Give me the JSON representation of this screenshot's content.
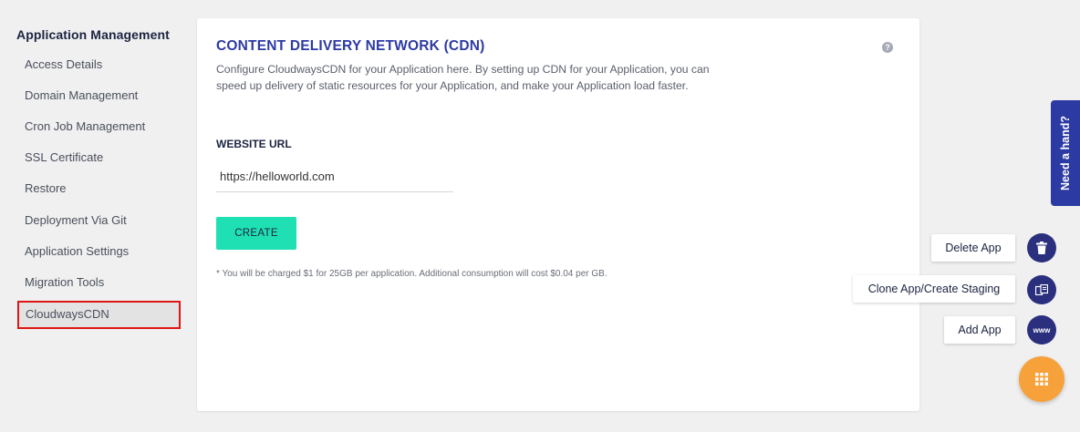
{
  "sidebar": {
    "heading": "Application Management",
    "items": [
      {
        "label": "Access Details"
      },
      {
        "label": "Domain Management"
      },
      {
        "label": "Cron Job Management"
      },
      {
        "label": "SSL Certificate"
      },
      {
        "label": "Restore"
      },
      {
        "label": "Deployment Via Git"
      },
      {
        "label": "Application Settings"
      },
      {
        "label": "Migration Tools"
      },
      {
        "label": "CloudwaysCDN"
      }
    ]
  },
  "card": {
    "title": "CONTENT DELIVERY NETWORK (CDN)",
    "help": "?",
    "description": "Configure CloudwaysCDN for your Application here. By setting up CDN for your Application, you can speed up delivery of static resources for your Application, and make your Application load faster.",
    "field_label": "WEBSITE URL",
    "url_value": "https://helloworld.com",
    "create_label": "CREATE",
    "note": "* You will be charged $1 for 25GB per application. Additional consumption will cost $0.04 per GB."
  },
  "help_tab": {
    "label": "Need a hand?"
  },
  "actions": {
    "delete": "Delete App",
    "clone": "Clone App/Create Staging",
    "add": "Add App",
    "www": "www"
  },
  "colors": {
    "accent": "#2c3aa3",
    "create_button": "#1fe0b3",
    "fab_main": "#f7a13a",
    "fab_circle": "#2a2f7e",
    "active_border": "#e01515"
  },
  "icons": {
    "help": "question-circle-icon",
    "delete": "trash-icon",
    "clone": "clone-icon",
    "add": "www-icon",
    "main_fab": "grid-icon"
  }
}
